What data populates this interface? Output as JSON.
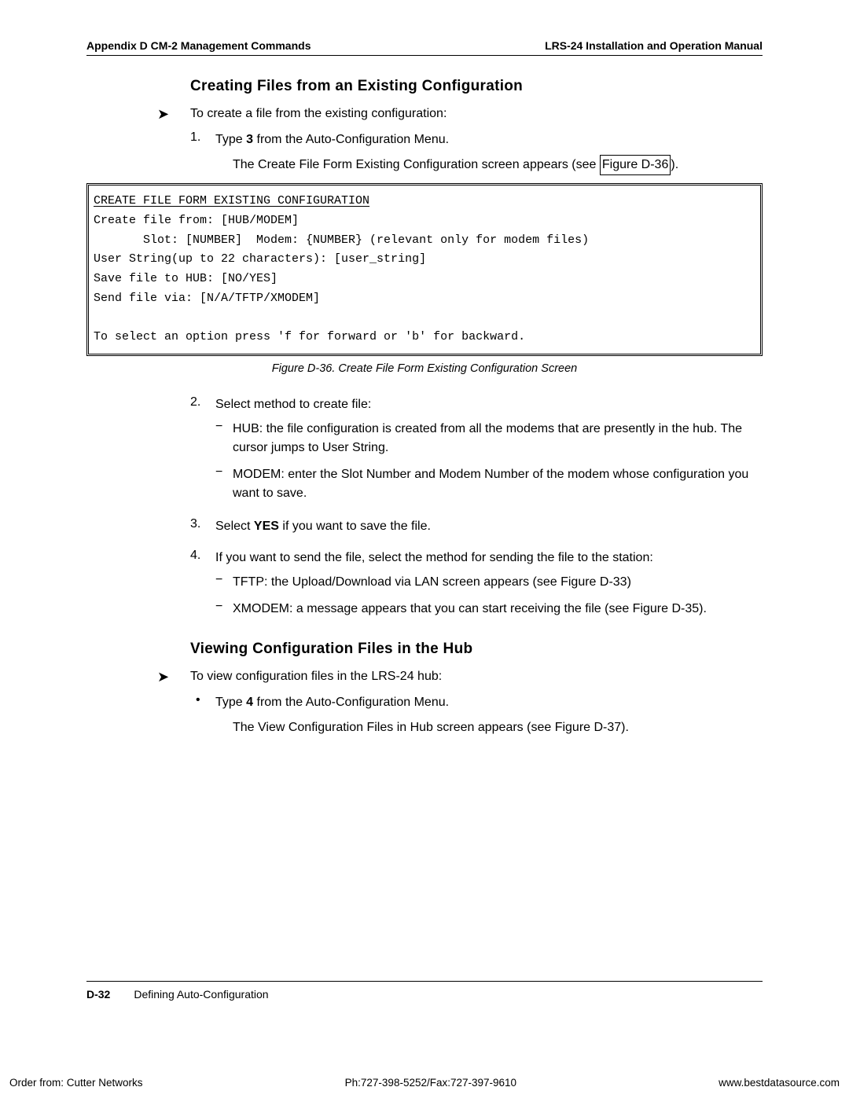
{
  "header": {
    "left": "Appendix D  CM-2 Management Commands",
    "right": "LRS-24 Installation and Operation Manual"
  },
  "section1": {
    "title": "Creating Files from an Existing Configuration",
    "lead": "To create a file from the existing configuration:",
    "step1_num": "1.",
    "step1_a": "Type ",
    "step1_b": "3",
    "step1_c": " from the Auto-Configuration Menu.",
    "step1_sub_a": "The Create File Form Existing Configuration screen appears (see ",
    "step1_sub_link": "Figure D-36",
    "step1_sub_b": ")."
  },
  "terminal": {
    "title": "CREATE FILE FORM EXISTING CONFIGURATION",
    "l1": "Create file from: [HUB/MODEM]",
    "l2": "       Slot: [NUMBER]  Modem: {NUMBER} (relevant only for modem files)",
    "l3": "User String(up to 22 characters): [user_string]",
    "l4": "Save file to HUB: [NO/YES]",
    "l5": "Send file via: [N/A/TFTP/XMODEM]",
    "l6": "To select an option press 'f for forward or 'b' for backward."
  },
  "fig_caption": "Figure D-36.  Create File Form Existing Configuration Screen",
  "steps2": {
    "s2_num": "2.",
    "s2_text": "Select method to create file:",
    "hub": "HUB: the file configuration is created from all the modems that are presently in the hub. The cursor jumps to User String.",
    "modem": "MODEM: enter the Slot Number and Modem Number of the modem whose configuration you want to save.",
    "s3_num": "3.",
    "s3_a": "Select ",
    "s3_b": "YES ",
    "s3_c": "if you want to save the file.",
    "s4_num": "4.",
    "s4_text": "If you want to send the file, select the method for sending the file to the station:",
    "tftp": "TFTP:  the Upload/Download  via LAN screen appears (see Figure D-33)",
    "xmodem": "XMODEM:  a message appears that you can start receiving the file (see Figure D-35)."
  },
  "section2": {
    "title": "Viewing Configuration Files in the Hub",
    "lead": "To view configuration files in the LRS-24 hub:",
    "b1_a": "Type ",
    "b1_b": "4",
    "b1_c": " from the Auto-Configuration Menu.",
    "b1_sub": "The View Configuration Files in Hub screen appears (see Figure D-37)."
  },
  "footer": {
    "page_num": "D-32",
    "title": "Defining Auto-Configuration"
  },
  "bottom": {
    "left": "Order from: Cutter Networks",
    "center": "Ph:727-398-5252/Fax:727-397-9610",
    "right": "www.bestdatasource.com"
  }
}
